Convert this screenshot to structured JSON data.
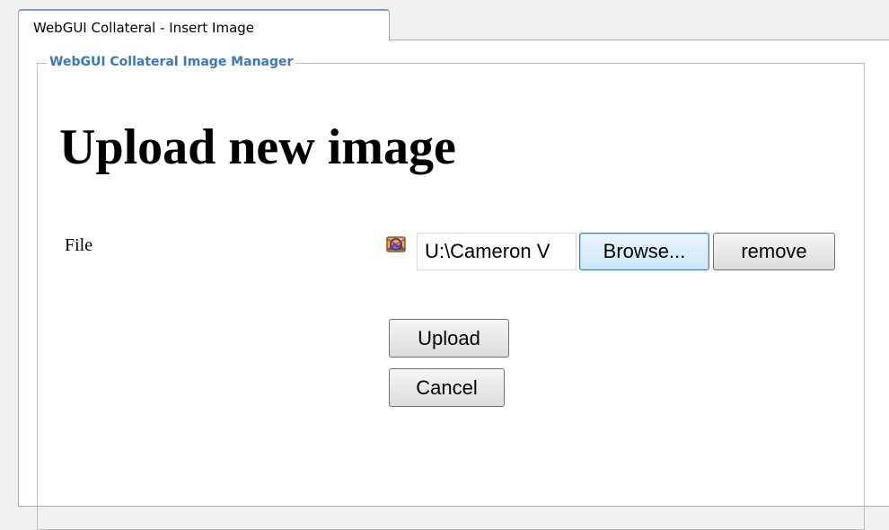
{
  "tab": {
    "label": "WebGUI Collateral - Insert Image"
  },
  "fieldset": {
    "legend": "WebGUI Collateral Image Manager"
  },
  "form": {
    "heading": "Upload new image",
    "file_label": "File",
    "file_icon": "image-file-icon",
    "file_path_value": "U:\\Cameron V",
    "browse_label": "Browse...",
    "remove_label": "remove",
    "upload_label": "Upload",
    "cancel_label": "Cancel"
  },
  "colors": {
    "legend": "#3a77bf",
    "window_background": "#f0f0ef",
    "panel_background": "#ffffff",
    "browse_button_highlight": "#cbe6f7"
  }
}
